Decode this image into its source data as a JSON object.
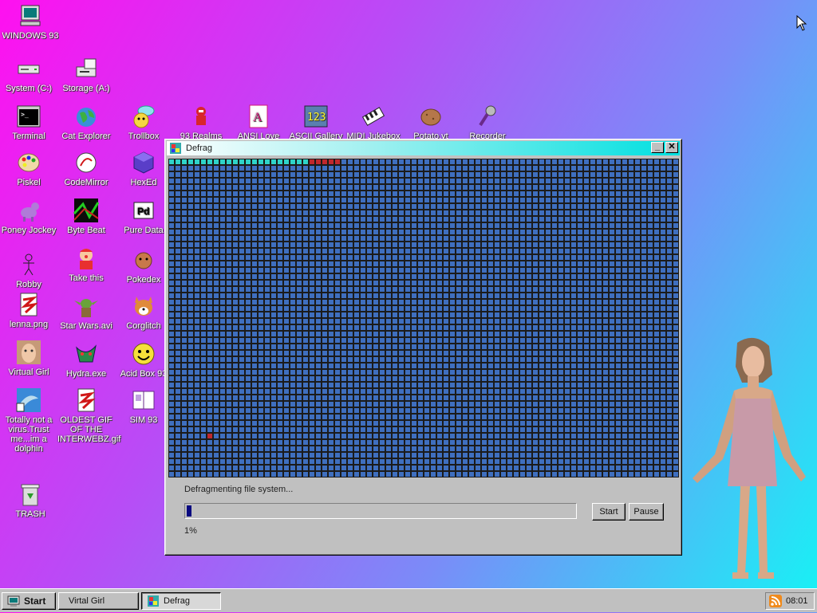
{
  "desktop": {
    "icons": [
      {
        "label": "WINDOWS 93",
        "icon": "computer-icon"
      },
      {
        "label": "System (C:)",
        "icon": "drive-icon"
      },
      {
        "label": "Storage (A:)",
        "icon": "floppy-drive-icon"
      },
      {
        "label": "Terminal",
        "icon": "terminal-icon"
      },
      {
        "label": "Cat Explorer",
        "icon": "globe-icon"
      },
      {
        "label": "Trollbox",
        "icon": "chat-icon"
      },
      {
        "label": "93 Realms",
        "icon": "knight-icon"
      },
      {
        "label": "ANSI Love",
        "icon": "ansi-icon"
      },
      {
        "label": "ASCII Gallery",
        "icon": "ascii-icon"
      },
      {
        "label": "MIDI Jukebox",
        "icon": "piano-icon"
      },
      {
        "label": "Potato.yt",
        "icon": "potato-icon"
      },
      {
        "label": "Recorder",
        "icon": "microphone-icon"
      },
      {
        "label": "Piskel",
        "icon": "palette-icon"
      },
      {
        "label": "CodeMirror",
        "icon": "codemirror-icon"
      },
      {
        "label": "HexEd",
        "icon": "cube-icon"
      },
      {
        "label": "Poney Jockey",
        "icon": "pony-icon"
      },
      {
        "label": "Byte Beat",
        "icon": "bytebeat-icon"
      },
      {
        "label": "Pure Data",
        "icon": "pd-icon"
      },
      {
        "label": "Robby",
        "icon": "stickman-icon"
      },
      {
        "label": "Take this",
        "icon": "clown-icon"
      },
      {
        "label": "Pokedex",
        "icon": "pokemon-icon"
      },
      {
        "label": "lenna.png",
        "icon": "image-file-icon"
      },
      {
        "label": "Star Wars.avi",
        "icon": "yoda-icon"
      },
      {
        "label": "Corglitch",
        "icon": "corgi-icon"
      },
      {
        "label": "Virtual Girl",
        "icon": "face-icon"
      },
      {
        "label": "Hydra.exe",
        "icon": "hydra-icon"
      },
      {
        "label": "Acid Box 93",
        "icon": "smiley-icon"
      },
      {
        "label": "Totally not a virus.Trust me...im a dolphin",
        "icon": "dolphin-icon"
      },
      {
        "label": "OLDEST GIF OF THE INTERWEBZ.gif",
        "icon": "gif-file-icon"
      },
      {
        "label": "SIM 93",
        "icon": "book-icon"
      },
      {
        "label": "TRASH",
        "icon": "trash-icon"
      }
    ]
  },
  "window": {
    "title": "Defrag",
    "minimize_label": "_",
    "close_label": "✕",
    "status": "Defragmenting file system...",
    "progress": 0.01,
    "progress_label": "1%",
    "start_label": "Start",
    "pause_label": "Pause",
    "grid": {
      "cols": 80,
      "rows": 50,
      "done_count": 22,
      "fragment_count": 5,
      "stray_fragment": {
        "row": 43,
        "col": 6
      },
      "colors": {
        "done": "#2fd4c8",
        "fragment": "#c0282c",
        "empty": "#3f6fbf",
        "gap": "#1b1b1b"
      }
    }
  },
  "taskbar": {
    "start_label": "Start",
    "tasks": [
      {
        "label": "Virtal Girl"
      },
      {
        "label": "Defrag"
      }
    ],
    "clock": "08:01"
  },
  "colors": {
    "desktop_gradient": [
      "#ff10f0",
      "#b84cf6",
      "#7a8cf8",
      "#16f3f5"
    ],
    "titlebar_accent": "#00e0e0",
    "window_face": "#c0c0c0"
  }
}
